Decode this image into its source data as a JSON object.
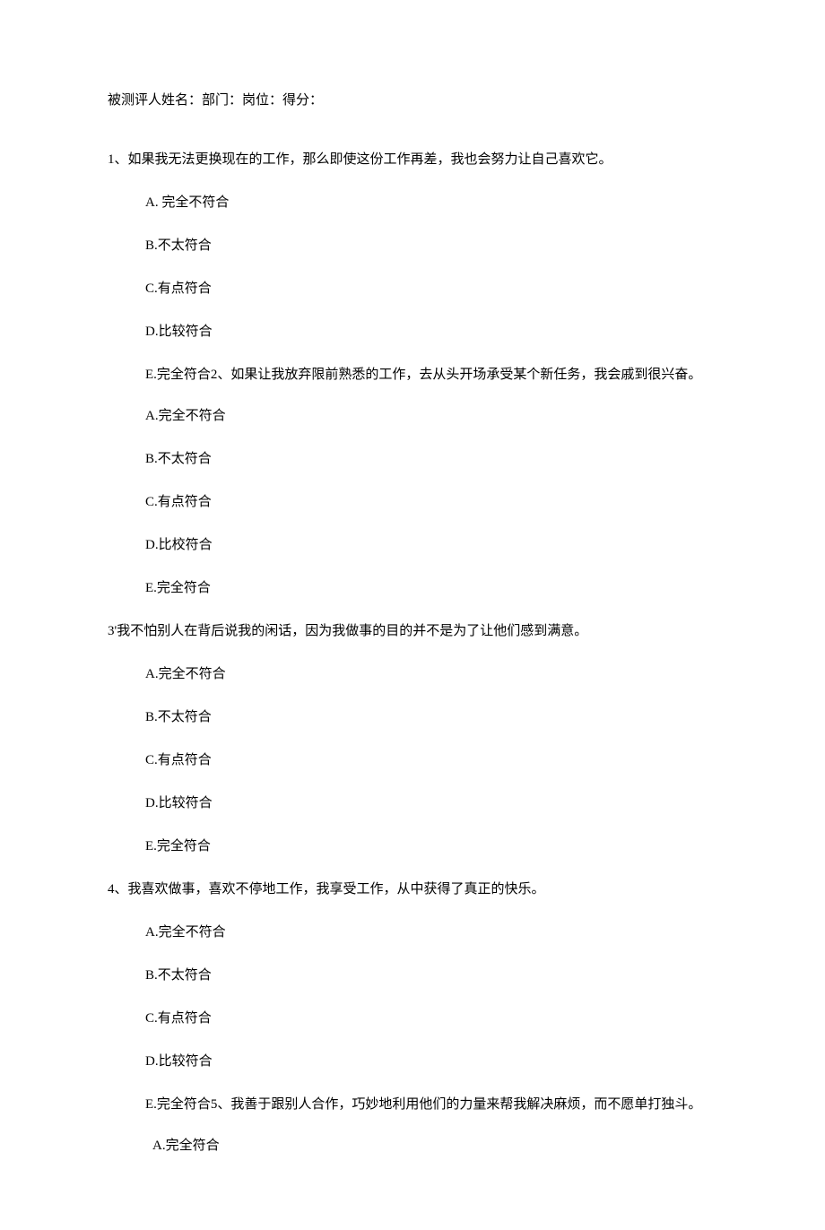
{
  "header": "被测评人姓名：部门：岗位：得分：",
  "q1": {
    "text": "1、如果我无法更换现在的工作，那么即使这份工作再差，我也会努力让自己喜欢它。",
    "a": "A.  完全不符合",
    "b": "B.不太符合",
    "c": "C.有点符合",
    "d": "D.比较符合",
    "e_q2": "E.完全符合2、如果让我放弃限前熟悉的工作，去从头开场承受某个新任务，我会戚到很兴奋。"
  },
  "q2": {
    "a": "A.完全不符合",
    "b": "B.不太符合",
    "c": "C.有点符合",
    "d": "D.比校符合",
    "e": "E.完全符合"
  },
  "q3": {
    "text": "3'我不怕别人在背后说我的闲话，因为我做事的目的并不是为了让他们感到满意。",
    "a": "A.完全不符合",
    "b": "B.不太符合",
    "c": "C.有点符合",
    "d": "D.比较符合",
    "e": "E.完全符合"
  },
  "q4": {
    "text": "4、我喜欢做事，喜欢不停地工作，我享受工作，从中获得了真正的快乐。",
    "a": "A.完全不符合",
    "b": "B.不太符合",
    "c": "C.有点符合",
    "d": "D.比较符合",
    "e_q5": "E.完全符合5、我善于跟别人合作，巧妙地利用他们的力量来帮我解决麻烦，而不愿单打独斗。"
  },
  "q5": {
    "a": "A.完全符合"
  }
}
